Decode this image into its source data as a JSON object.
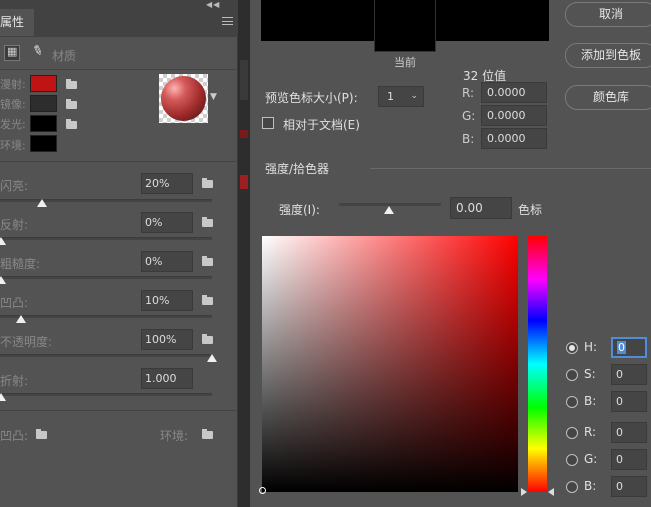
{
  "properties": {
    "tab_label": "属性",
    "material_tab": "材质",
    "material_rows": [
      {
        "label": "漫射:",
        "color": "#c01414"
      },
      {
        "label": "镜像:",
        "color": "#2d2d2d"
      },
      {
        "label": "发光:",
        "color": "#000000"
      },
      {
        "label": "环境:",
        "color": "#000000"
      }
    ],
    "params": [
      {
        "label": "闪亮:",
        "value": "20%",
        "level": 0.2
      },
      {
        "label": "反射:",
        "value": "0%",
        "level": 0.0
      },
      {
        "label": "粗糙度:",
        "value": "0%",
        "level": 0.0
      },
      {
        "label": "凹凸:",
        "value": "10%",
        "level": 0.1
      },
      {
        "label": "不透明度:",
        "value": "100%",
        "level": 1.0
      },
      {
        "label": "折射:",
        "value": "1.000",
        "level": 0.0
      }
    ],
    "bottom": {
      "bump_label": "凹凸:",
      "env_label": "环境:"
    }
  },
  "picker": {
    "current_label": "当前",
    "buttons": {
      "cancel": "取消",
      "add_swatch": "添加到色板",
      "library": "颜色库"
    },
    "preview_size_label": "预览色标大小(P):",
    "preview_size_value": "1",
    "relative_label": "相对于文档(E)",
    "bit_label": "32 位值",
    "float_fields": [
      {
        "label": "R:",
        "value": "0.0000"
      },
      {
        "label": "G:",
        "value": "0.0000"
      },
      {
        "label": "B:",
        "value": "0.0000"
      }
    ],
    "section_title": "强度/拾色器",
    "strength_label": "强度(I):",
    "strength_value": "0.00",
    "swatch_label": "色标",
    "hsb": [
      {
        "label": "H:",
        "value": "0"
      },
      {
        "label": "S:",
        "value": "0"
      },
      {
        "label": "B:",
        "value": "0"
      }
    ],
    "rgb": [
      {
        "label": "R:",
        "value": "0"
      },
      {
        "label": "G:",
        "value": "0"
      },
      {
        "label": "B:",
        "value": "0"
      }
    ]
  }
}
